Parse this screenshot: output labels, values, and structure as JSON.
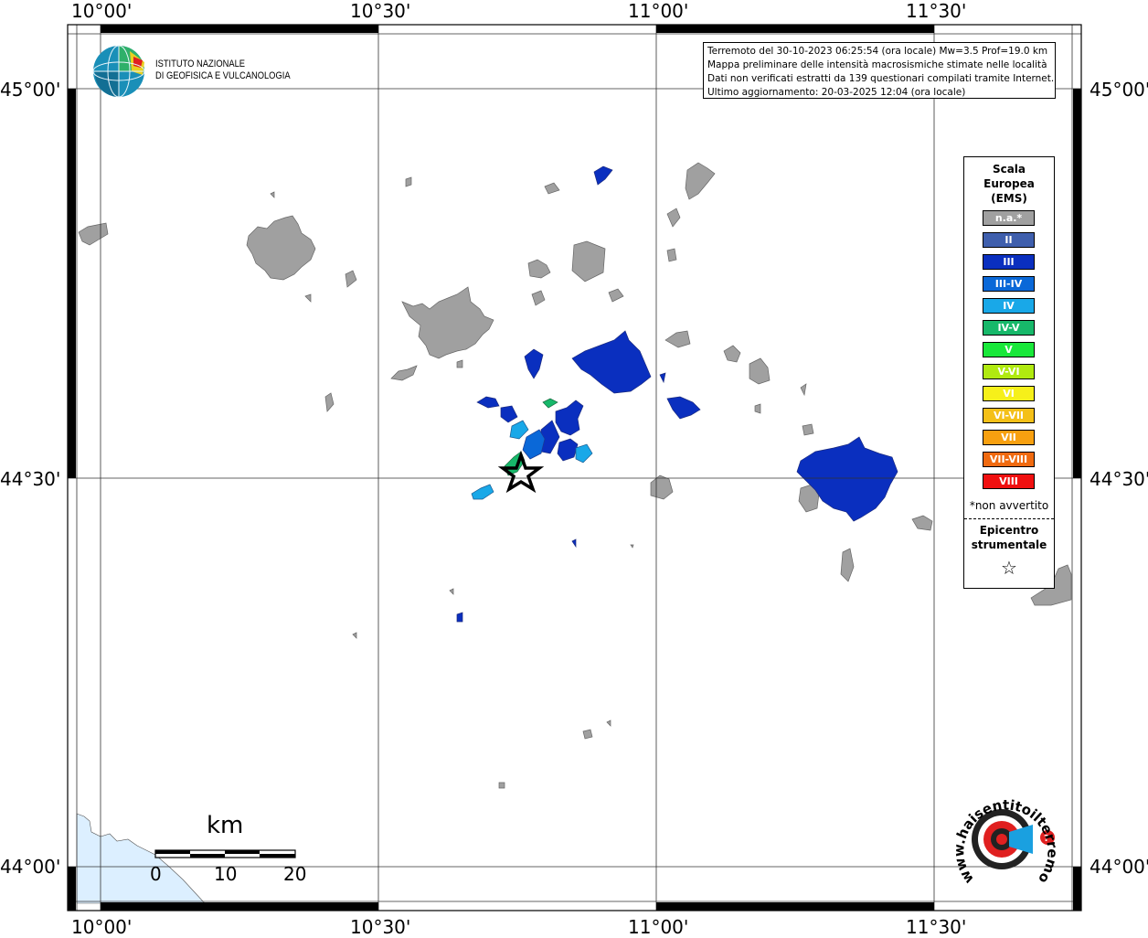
{
  "info": {
    "line1": "Terremoto del 30-10-2023 06:25:54 (ora locale) Mw=3.5 Prof=19.0 km",
    "line2": "Mappa preliminare delle intensità macrosismiche stimate nelle località",
    "line3": "Dati non verificati estratti da 139 questionari compilati tramite Internet.",
    "line4": "Ultimo aggiornamento: 20-03-2025 12:04 (ora locale)"
  },
  "logo": {
    "line1": "ISTITUTO NAZIONALE",
    "line2": "DI GEOFISICA E VULCANOLOGIA",
    "hst_text": "www.haisentitoilterremoto.it"
  },
  "axes": {
    "top": [
      "10°00'",
      "10°30'",
      "11°00'",
      "11°30'"
    ],
    "bottom": [
      "10°00'",
      "10°30'",
      "11°00'",
      "11°30'"
    ],
    "left": [
      "45°00'",
      "44°30'",
      "44°00'"
    ],
    "right": [
      "45°00'",
      "44°30'",
      "44°00'"
    ]
  },
  "legend": {
    "title_line1": "Scala",
    "title_line2": "Europea",
    "title_line3": "(EMS)",
    "items": [
      {
        "label": "n.a.*",
        "color": "#a0a0a0"
      },
      {
        "label": "II",
        "color": "#3f5fad"
      },
      {
        "label": "III",
        "color": "#0a2fbf"
      },
      {
        "label": "III-IV",
        "color": "#0a68d8"
      },
      {
        "label": "IV",
        "color": "#19a8e8"
      },
      {
        "label": "IV-V",
        "color": "#17b86a"
      },
      {
        "label": "V",
        "color": "#19e83a"
      },
      {
        "label": "V-VI",
        "color": "#b0ea10"
      },
      {
        "label": "VI",
        "color": "#f6f01a"
      },
      {
        "label": "VI-VII",
        "color": "#f4c018"
      },
      {
        "label": "VII",
        "color": "#f8a010"
      },
      {
        "label": "VII-VIII",
        "color": "#f06a10"
      },
      {
        "label": "VIII",
        "color": "#f01010"
      }
    ],
    "note": "*non avvertito",
    "epicenter_line1": "Epicentro",
    "epicenter_line2": "strumentale",
    "star": "☆"
  },
  "scale_bar": {
    "title": "km",
    "labels": [
      "0",
      "10",
      "20"
    ]
  },
  "colors": {
    "sea": "#dcefff",
    "na": "#a0a0a0",
    "ii": "#3f5fad",
    "iii": "#0a2fbf",
    "iii_iv": "#0a68d8",
    "iv": "#19a8e8",
    "iv_v": "#17b86a"
  }
}
